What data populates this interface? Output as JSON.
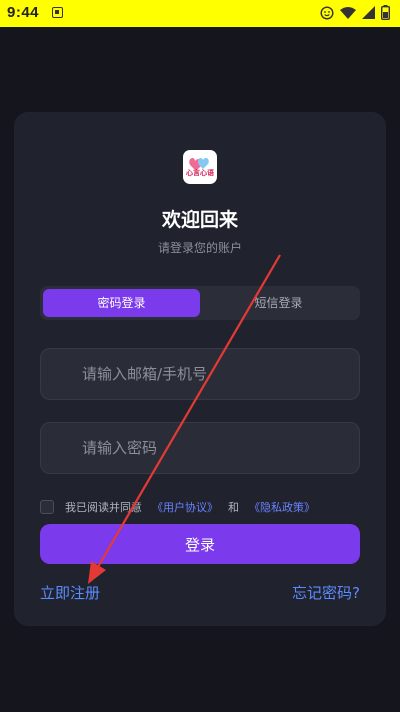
{
  "status_bar": {
    "time": "9:44",
    "icons": [
      "notification-icon",
      "face-icon",
      "wifi-icon",
      "signal-icon",
      "battery-icon"
    ]
  },
  "app": {
    "logo_text": "心言心语",
    "title": "欢迎回来",
    "subtitle": "请登录您的账户"
  },
  "tabs": {
    "password_login": "密码登录",
    "sms_login": "短信登录",
    "active": "password_login"
  },
  "form": {
    "account_placeholder": "请输入邮箱/手机号",
    "password_placeholder": "请输入密码",
    "agree_text": "我已阅读并同意",
    "user_agreement": "《用户协议》",
    "and_text": "和",
    "privacy_policy": "《隐私政策》",
    "agree_checked": false,
    "login_label": "登录"
  },
  "footer": {
    "register": "立即注册",
    "forgot_password": "忘记密码?"
  },
  "colors": {
    "accent": "#7c3aed",
    "link": "#5b8cff",
    "annotation": "#e53935",
    "status_bar": "#ffff00"
  }
}
